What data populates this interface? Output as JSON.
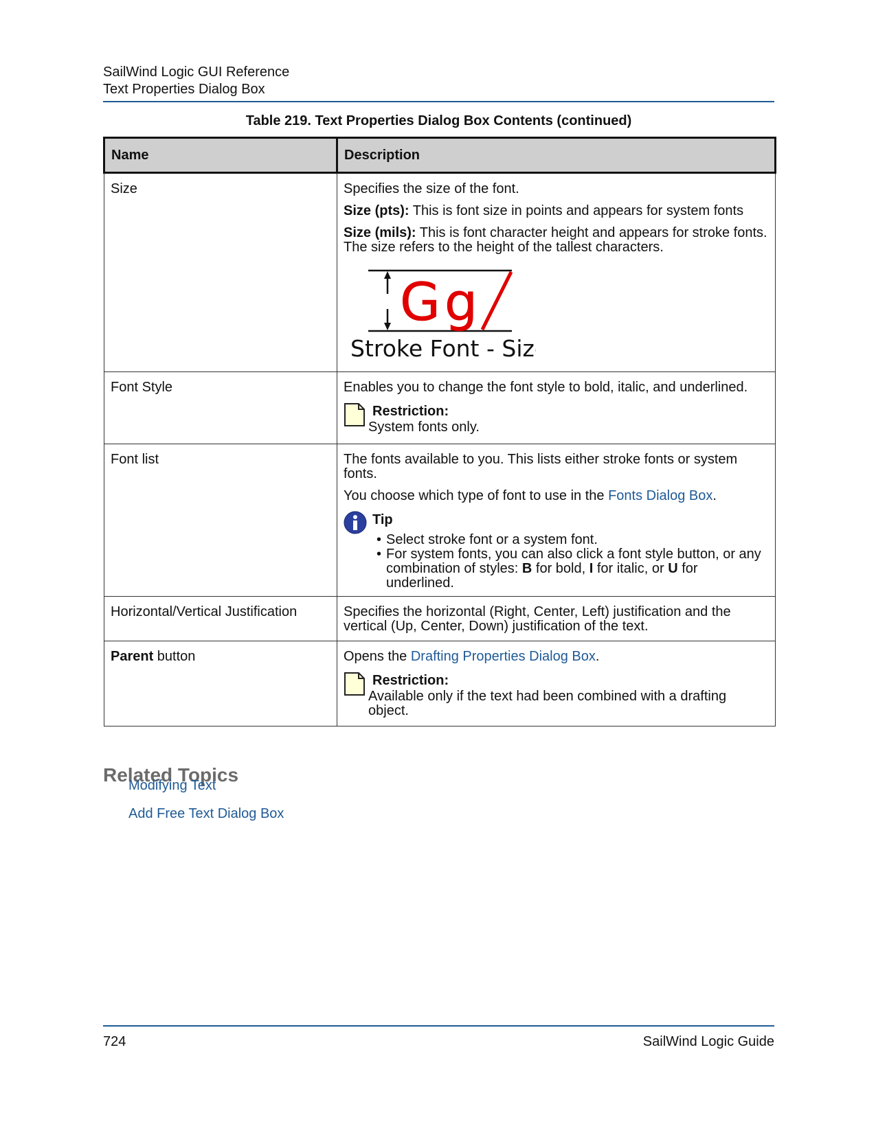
{
  "header": {
    "doc_title": "SailWind Logic GUI Reference",
    "section_title": "Text Properties Dialog Box"
  },
  "table": {
    "caption": "Table 219. Text Properties Dialog Box Contents (continued)",
    "col_name": "Name",
    "col_description": "Description",
    "size": {
      "name": "Size",
      "desc1": "Specifies the size of the font.",
      "pts_label": "Size (pts):",
      "pts_text": " This is font size in points and appears for system fonts",
      "mils_label": "Size (mils):",
      "mils_text": " This is font character height and appears for stroke fonts. The size refers to the height of the tallest characters.",
      "figure_glyphs": "Gg",
      "figure_label": "Stroke Font - Size"
    },
    "font_style": {
      "name": "Font Style",
      "desc": "Enables you to change the font style to bold, italic, and underlined.",
      "note_title": "Restriction:",
      "note_body": "System fonts only."
    },
    "font_list": {
      "name": "Font list",
      "desc1": "The fonts available to you. This lists either stroke fonts or system fonts.",
      "desc2_before": "You choose which type of font to use in the ",
      "desc2_link": "Fonts Dialog Box",
      "desc2_after": ".",
      "tip_title": "Tip",
      "tip1": "Select stroke font or a system font.",
      "tip2_a": "For system fonts, you can also click a font style button, or any combination of styles: ",
      "tip2_b": "B",
      "tip2_c": " for bold, ",
      "tip2_d": "I",
      "tip2_e": " for italic, or ",
      "tip2_f": "U",
      "tip2_g": " for underlined."
    },
    "justification": {
      "name": "Horizontal/Vertical Justification",
      "desc": "Specifies the horizontal (Right, Center, Left) justification and the vertical (Up, Center, Down) justification of the text."
    },
    "parent": {
      "name_bold": "Parent",
      "name_rest": " button",
      "desc_before": "Opens the ",
      "desc_link": "Drafting Properties Dialog Box",
      "desc_after": ".",
      "note_title": "Restriction:",
      "note_body": "Available only if the text had been combined with a drafting object."
    }
  },
  "related": {
    "title": "Related Topics",
    "links": [
      "Modifying Text",
      "Add Free Text Dialog Box"
    ]
  },
  "footer": {
    "page_number": "724",
    "guide_title": "SailWind Logic Guide"
  },
  "colors": {
    "link": "#1f5a96",
    "rule": "#1f5a96",
    "header_fill": "#cfcfcf",
    "figure_red": "#e00000"
  },
  "icons": [
    "note-icon",
    "info-icon"
  ]
}
